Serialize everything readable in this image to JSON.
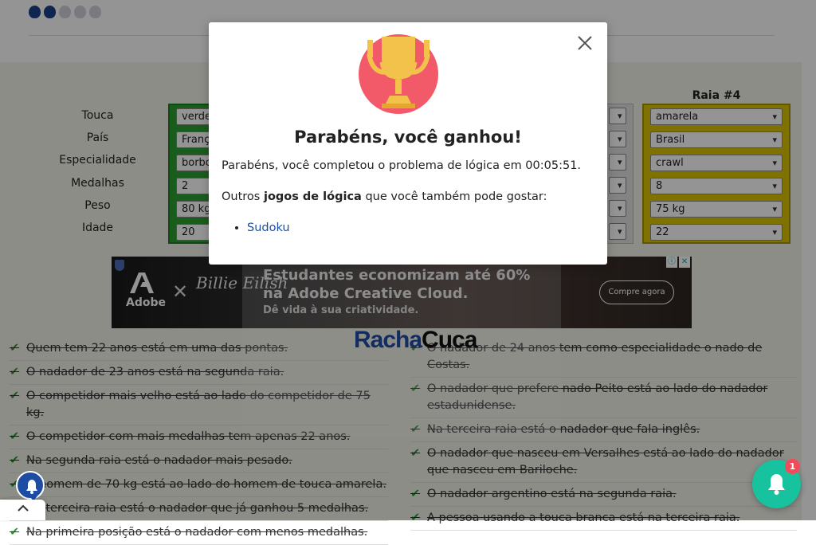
{
  "colors": {
    "accent_blue": "#1f4fa8",
    "check_green": "#2a9a2a",
    "lane1_green": "#2ba133",
    "lane4_yellow": "#dcc500",
    "notify_teal": "#16c39e",
    "badge_red": "#f24a5a"
  },
  "difficulty": {
    "filled": 2,
    "total": 5,
    "icon": "brain-icon"
  },
  "puzzle": {
    "row_labels": [
      "Touca",
      "País",
      "Especialidade",
      "Medalhas",
      "Peso",
      "Idade"
    ],
    "lane1": {
      "values": [
        "verde",
        "França",
        "borboleta",
        "2",
        "80 kg",
        "20"
      ]
    },
    "lane4": {
      "title": "Raia #4",
      "values": [
        "amarela",
        "Brasil",
        "crawl",
        "8",
        "75 kg",
        "22"
      ]
    }
  },
  "ad": {
    "brand": "Adobe",
    "collab": "Billie Eilish",
    "headline": "Estudantes economizam até 60% na Adobe Creative Cloud.",
    "subline": "Dê vida à sua criatividade.",
    "cta": "Compre agora"
  },
  "logo": {
    "part1": "Racha",
    "part2": "Cuca"
  },
  "clues_left": [
    "Quem tem 22 anos está em uma das pontas.",
    "O nadador de 23 anos está na segunda raia.",
    "O competidor mais velho está ao lado do competidor de 75 kg.",
    "O competidor com mais medalhas tem apenas 22 anos.",
    "Na segunda raia está o nadador mais pesado.",
    "O homem de 70 kg está ao lado do homem de touca amarela.",
    "Na terceira raia está o nadador que já ganhou 5 medalhas.",
    "Na primeira posição está o nadador com menos medalhas."
  ],
  "clues_right": [
    "O nadador de 24 anos tem como especialidade o nado de Costas.",
    "O nadador que prefere nado Peito está ao lado do nadador estadunidense.",
    "Na terceira raia está o nadador que fala inglês.",
    "O nadador que nasceu em Versalhes está ao lado do nadador que nasceu em Bariloche.",
    "O nadador argentino está na segunda raia.",
    "A pessoa usando a touca branca está na terceira raia."
  ],
  "modal": {
    "title": "Parabéns, você ganhou!",
    "message": "Parabéns, você completou o problema de lógica em 00:05:51.",
    "others_prefix": "Outros ",
    "others_bold": "jogos de lógica",
    "others_suffix": " que você também pode gostar:",
    "links": [
      "Sudoku"
    ]
  },
  "notifications": {
    "badge_count": "1"
  }
}
